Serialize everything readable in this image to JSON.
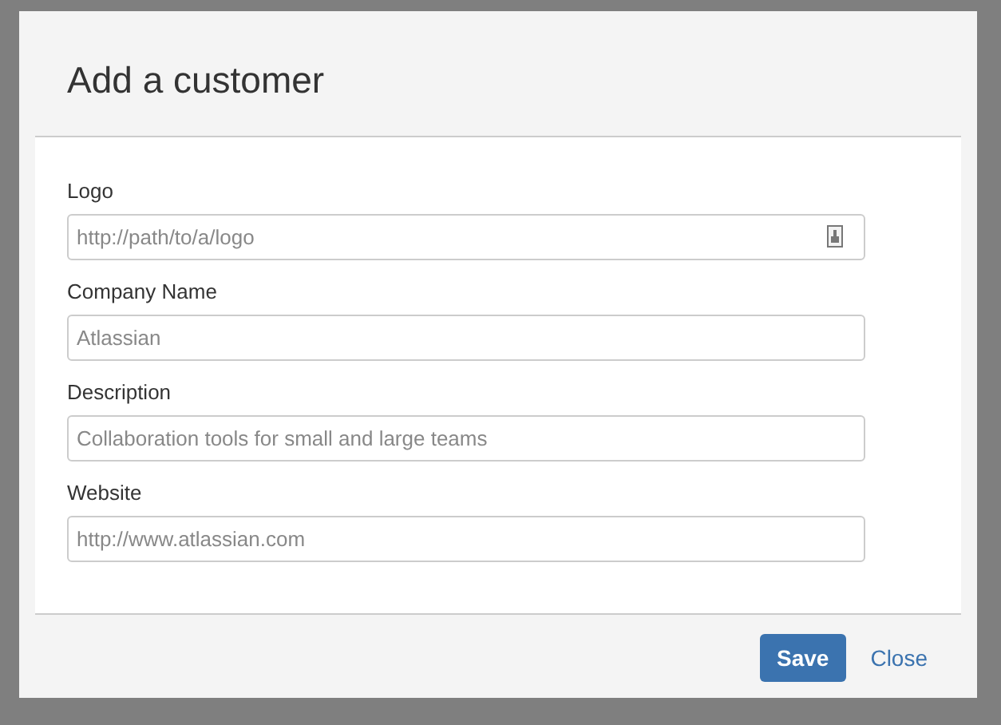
{
  "dialog": {
    "title": "Add a customer",
    "fields": [
      {
        "label": "Logo",
        "placeholder": "http://path/to/a/logo",
        "kind": "image"
      },
      {
        "label": "Company Name",
        "placeholder": "Atlassian",
        "kind": "text"
      },
      {
        "label": "Description",
        "placeholder": "Collaboration tools for small and large teams",
        "kind": "text"
      },
      {
        "label": "Website",
        "placeholder": "http://www.atlassian.com",
        "kind": "text"
      }
    ],
    "buttons": [
      {
        "label": "Save",
        "kind": "primary"
      },
      {
        "label": "Close",
        "kind": "link"
      }
    ]
  }
}
